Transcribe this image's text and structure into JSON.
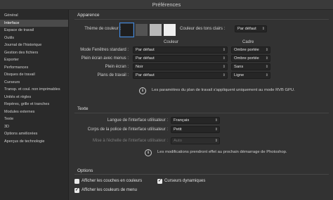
{
  "window": {
    "title": "Préférences"
  },
  "sidebar": {
    "items": [
      "Général",
      "Interface",
      "Espace de travail",
      "Outils",
      "Journal de l'historique",
      "Gestion des fichiers",
      "Exporter",
      "Performances",
      "Disques de travail",
      "Curseurs",
      "Transp. et coul. non imprimables",
      "Unités et règles",
      "Repères, grille et tranches",
      "Modules externes",
      "Texte",
      "3D",
      "Options améliorées",
      "Aperçus de technologie"
    ],
    "active_index": 1
  },
  "appearance": {
    "title": "Apparence",
    "theme_label": "Thème de couleur :",
    "swatches": [
      "#1e1e1e",
      "#535353",
      "#b8b8b8",
      "#efefef"
    ],
    "selected_swatch": 0,
    "highlight_label": "Couleur des tons clairs :",
    "highlight_value": "Par défaut",
    "col_color": "Couleur",
    "col_border": "Cadre",
    "rows": [
      {
        "label": "Mode Fenêtres standard :",
        "color": "Par défaut",
        "border": "Ombre portée"
      },
      {
        "label": "Plein écran avec menus :",
        "color": "Par défaut",
        "border": "Ombre portée"
      },
      {
        "label": "Plein écran :",
        "color": "Noir",
        "border": "Sans"
      },
      {
        "label": "Plans de travail :",
        "color": "Par défaut",
        "border": "Ligne"
      }
    ],
    "note": "Les paramètres du plan de travail s'appliquent uniquement au mode RVB GPU."
  },
  "text": {
    "title": "Texte",
    "ui_language_label": "Langue de l'interface utilisateur :",
    "ui_language_value": "Français",
    "ui_font_size_label": "Corps de la police de l'interface utilisateur :",
    "ui_font_size_value": "Petit",
    "ui_scale_label": "Mise à l'échelle de l'interface utilisateur :",
    "ui_scale_value": "Auto",
    "note": "Les modifications prendront effet au prochain démarrage de Photoshop."
  },
  "options": {
    "title": "Options",
    "channels_label": "Afficher les couches en couleurs",
    "channels_checked": false,
    "dynamic_cursors_label": "Curseurs dynamiques",
    "dynamic_cursors_checked": true,
    "menu_colors_label": "Afficher les couleurs de menu",
    "menu_colors_checked": true
  },
  "icons": {
    "dropdown": "chevron-updown-icon",
    "info": "info-icon",
    "check": "checkmark-icon"
  }
}
